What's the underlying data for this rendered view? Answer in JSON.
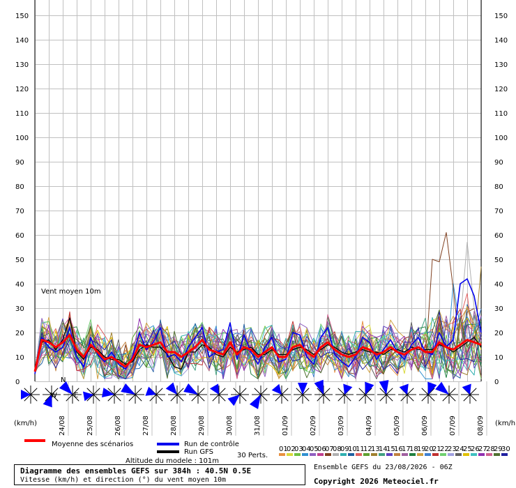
{
  "chart_data": {
    "type": "line",
    "title": "Vent moyen 10m",
    "ylabel_left": "(km/h)",
    "ylabel_right": "(km/h)",
    "ylim": [
      0,
      155
    ],
    "yticks": [
      0,
      10,
      20,
      30,
      40,
      50,
      60,
      70,
      80,
      90,
      100,
      110,
      120,
      130,
      140,
      150
    ],
    "x_dates": [
      "24/08",
      "25/08",
      "26/08",
      "27/08",
      "28/08",
      "29/08",
      "30/08",
      "31/08",
      "01/09",
      "02/09",
      "03/09",
      "04/09",
      "05/09",
      "06/09",
      "07/09",
      "08/09"
    ],
    "grid": true,
    "legend": {
      "mean": "Moyenne des scénarios",
      "control": "Run de contrôle",
      "gfs": "Run GFS",
      "perts": "30 Perts.",
      "pert_labels": [
        "01",
        "02",
        "03",
        "04",
        "05",
        "06",
        "07",
        "08",
        "09",
        "10",
        "11",
        "12",
        "13",
        "14",
        "15",
        "16",
        "17",
        "18",
        "19",
        "20",
        "21",
        "22",
        "23",
        "24",
        "25",
        "26",
        "27",
        "28",
        "29",
        "30"
      ]
    },
    "series": [
      {
        "name": "Moyenne des scénarios",
        "color": "#ff0000",
        "values": [
          4,
          17,
          16,
          14,
          16,
          19,
          13,
          10,
          15,
          12,
          9,
          10,
          8,
          6,
          9,
          15,
          14,
          15,
          16,
          12,
          12,
          10,
          12,
          14,
          17,
          13,
          12,
          11,
          16,
          11,
          14,
          13,
          10,
          12,
          14,
          10,
          10,
          14,
          15,
          12,
          10,
          14,
          16,
          13,
          11,
          10,
          11,
          14,
          13,
          11,
          12,
          14,
          12,
          11,
          13,
          14,
          12,
          12,
          16,
          14,
          13,
          15,
          17,
          16,
          15
        ]
      },
      {
        "name": "Run de contrôle",
        "color": "#0000ee",
        "values": [
          3,
          18,
          14,
          12,
          14,
          22,
          10,
          6,
          18,
          11,
          8,
          12,
          7,
          5,
          10,
          20,
          13,
          16,
          22,
          10,
          11,
          8,
          14,
          18,
          22,
          10,
          12,
          13,
          24,
          9,
          19,
          12,
          7,
          14,
          18,
          8,
          9,
          20,
          19,
          10,
          7,
          18,
          22,
          11,
          8,
          6,
          10,
          18,
          16,
          9,
          13,
          17,
          12,
          9,
          15,
          18,
          12,
          11,
          20,
          14,
          17,
          40,
          42,
          35,
          20
        ]
      },
      {
        "name": "Run GFS",
        "color": "#000000",
        "values": [
          4,
          16,
          17,
          13,
          17,
          26,
          12,
          9,
          14,
          13,
          10,
          9,
          9,
          7,
          8,
          13,
          15,
          14,
          14,
          11,
          6,
          5,
          12,
          12,
          15,
          14,
          11,
          10,
          14,
          12,
          13,
          14,
          11,
          11,
          13,
          11,
          11,
          13,
          14,
          13,
          11,
          13,
          15,
          14,
          12,
          11,
          12,
          13,
          12,
          12,
          11,
          13,
          13,
          12,
          14,
          13,
          13,
          13,
          15,
          14,
          12,
          14,
          16,
          18,
          14
        ]
      }
    ],
    "wind_directions": [
      270,
      200,
      315,
      260,
      280,
      300,
      290,
      320,
      300,
      330,
      230,
      210,
      320,
      0,
      340,
      20,
      20,
      350,
      340,
      20,
      310,
      340
    ]
  },
  "legend_ui": {
    "mean_label": "Moyenne des scénarios",
    "control_label": "Run de contrôle",
    "gfs_label": "Run GFS",
    "perts_label": "30 Perts.",
    "altitude": "Altitude du modele : 101m",
    "run_info": "Ensemble GEFS du 23/08/2026 - 06Z",
    "copyright": "Copyright 2026 Meteociel.fr",
    "compass_n": "N",
    "compass_w": "W",
    "compass_e": "E"
  },
  "info": {
    "title": "Diagramme des ensembles GEFS sur 384h : 40.5N 0.5E",
    "subtitle": "Vitesse (km/h) et direction (°) du vent moyen 10m"
  },
  "colors": {
    "mean": "#ff0000",
    "control": "#0000ee",
    "gfs": "#000000",
    "grid": "#c0c0c0",
    "rose": "#0000ff",
    "perts": [
      "#e89040",
      "#d9d93a",
      "#70c040",
      "#3090d0",
      "#9060c0",
      "#c04090",
      "#804020",
      "#b0b0b0",
      "#30b0b0",
      "#2060a0",
      "#e06060",
      "#60a030",
      "#a08030",
      "#40a080",
      "#6040c0",
      "#c08040",
      "#a060a0",
      "#208040",
      "#d0a040",
      "#4080d0",
      "#c03030",
      "#70d070",
      "#a0a0e0",
      "#606060",
      "#e0c000",
      "#40c0c0",
      "#9030b0",
      "#d06090",
      "#507030",
      "#2020a0"
    ]
  }
}
